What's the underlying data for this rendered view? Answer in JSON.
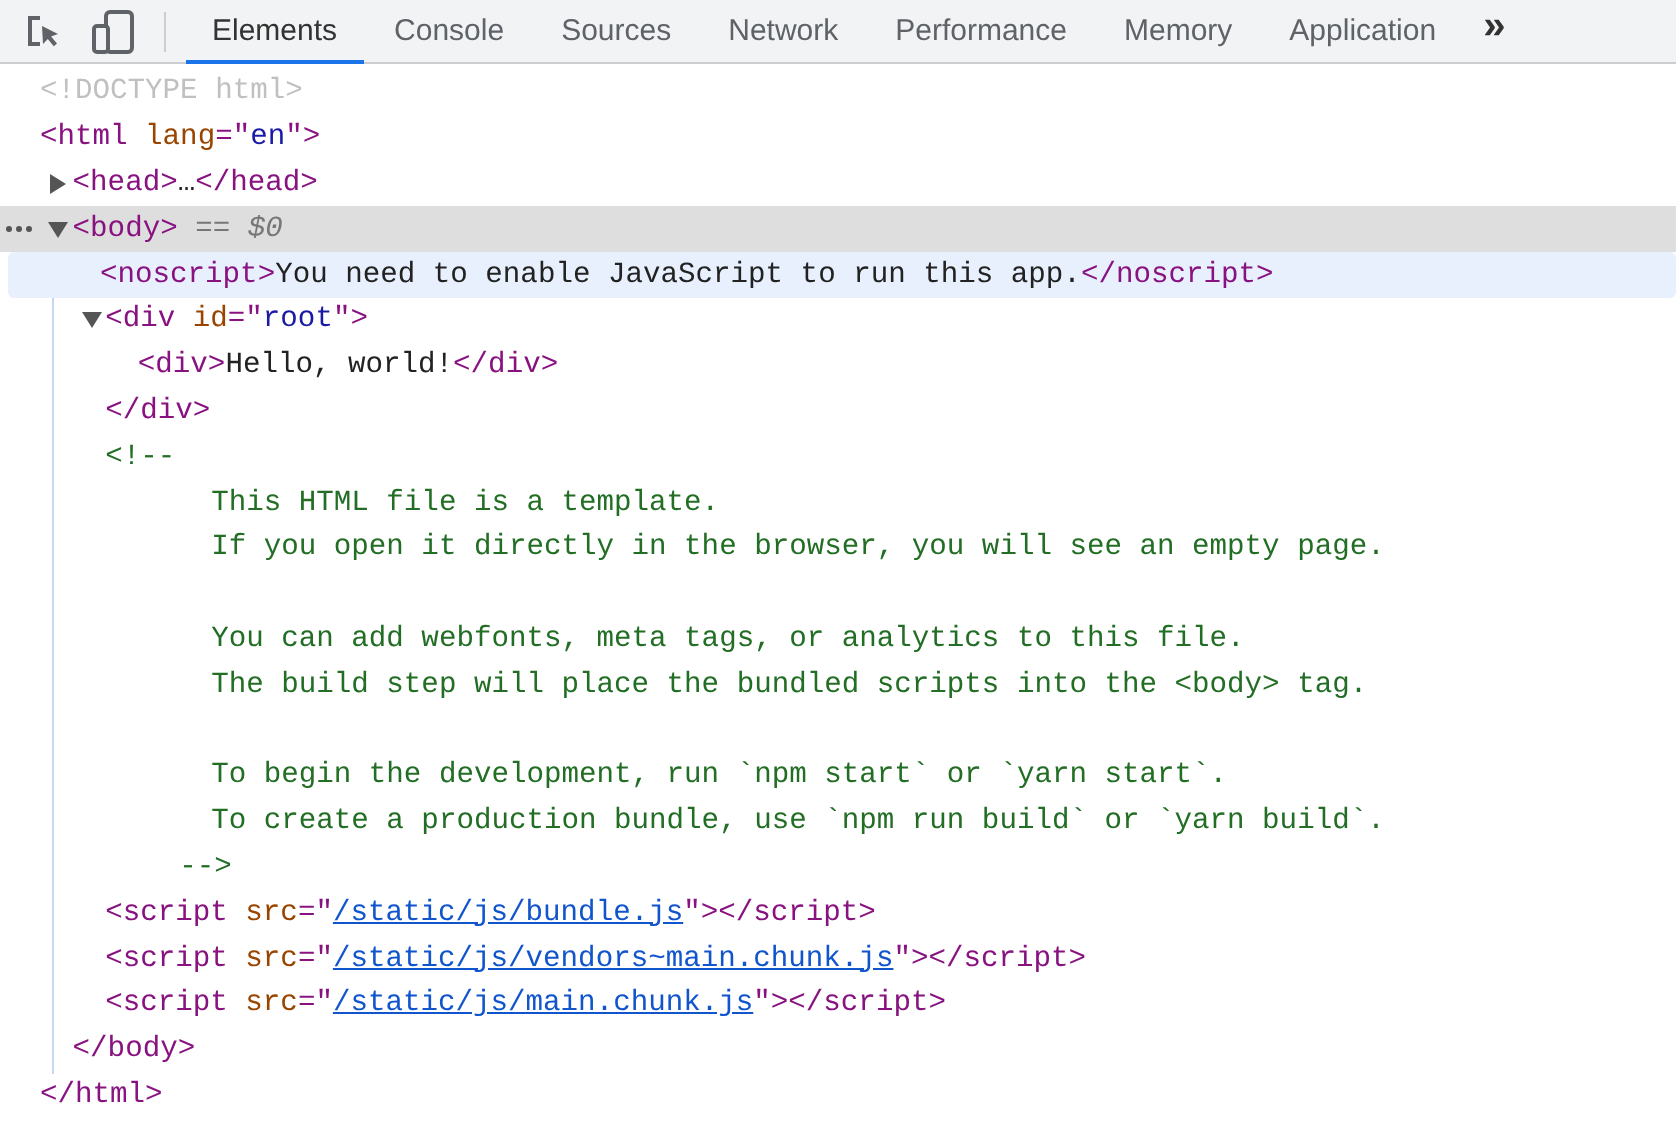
{
  "tabs": [
    {
      "label": "Elements",
      "selected": true
    },
    {
      "label": "Console",
      "selected": false
    },
    {
      "label": "Sources",
      "selected": false
    },
    {
      "label": "Network",
      "selected": false
    },
    {
      "label": "Performance",
      "selected": false
    },
    {
      "label": "Memory",
      "selected": false
    },
    {
      "label": "Application",
      "selected": false
    }
  ],
  "overflow": "»",
  "tree": [
    {
      "kind": "element",
      "open": [
        {
          "kind": "doctype",
          "text": "<!DOCTYPE html>"
        }
      ]
    },
    {
      "kind": "element",
      "open": [
        {
          "kind": "tag",
          "text": "<html "
        },
        {
          "kind": "attr-name",
          "text": "lang"
        },
        {
          "kind": "tag",
          "text": "=\""
        },
        {
          "kind": "attr-value",
          "text": "en"
        },
        {
          "kind": "tag",
          "text": "\">"
        }
      ],
      "close": [
        {
          "kind": "tag",
          "text": "</html>"
        }
      ],
      "children": [
        {
          "kind": "element",
          "expanded": false,
          "open": [
            {
              "kind": "tag",
              "text": "<head>"
            },
            {
              "kind": "text",
              "text": "…"
            },
            {
              "kind": "tag",
              "text": "</head>"
            }
          ]
        },
        {
          "kind": "element",
          "expanded": true,
          "selected": true,
          "suffix": "== $0",
          "open": [
            {
              "kind": "tag",
              "text": "<body>"
            }
          ],
          "close": [
            {
              "kind": "tag",
              "text": "</body>"
            }
          ],
          "children": [
            {
              "kind": "element",
              "hovered": true,
              "open": [
                {
                  "kind": "tag",
                  "text": "<noscript>"
                },
                {
                  "kind": "text",
                  "text": "You need to enable JavaScript to run this app."
                },
                {
                  "kind": "tag",
                  "text": "</noscript>"
                }
              ]
            },
            {
              "kind": "element",
              "expanded": true,
              "open": [
                {
                  "kind": "tag",
                  "text": "<div "
                },
                {
                  "kind": "attr-name",
                  "text": "id"
                },
                {
                  "kind": "tag",
                  "text": "=\""
                },
                {
                  "kind": "attr-value",
                  "text": "root"
                },
                {
                  "kind": "tag",
                  "text": "\">"
                }
              ],
              "close": [
                {
                  "kind": "tag",
                  "text": "</div>"
                }
              ],
              "children": [
                {
                  "kind": "element",
                  "open": [
                    {
                      "kind": "tag",
                      "text": "<div>"
                    },
                    {
                      "kind": "text",
                      "text": "Hello, world!"
                    },
                    {
                      "kind": "tag",
                      "text": "</div>"
                    }
                  ]
                }
              ]
            },
            {
              "kind": "comment",
              "open": "<!--",
              "close": "-->",
              "paragraphs": [
                [
                  "This HTML file is a template.",
                  "If you open it directly in the browser, you will see an empty page."
                ],
                [
                  "You can add webfonts, meta tags, or analytics to this file.",
                  "The build step will place the bundled scripts into the <body> tag."
                ],
                [
                  "To begin the development, run `npm start` or `yarn start`.",
                  "To create a production bundle, use `npm run build` or `yarn build`."
                ]
              ]
            },
            {
              "kind": "element",
              "open": [
                {
                  "kind": "tag",
                  "text": "<script "
                },
                {
                  "kind": "attr-name",
                  "text": "src"
                },
                {
                  "kind": "tag",
                  "text": "=\""
                },
                {
                  "kind": "link",
                  "text": "/static/js/bundle.js"
                },
                {
                  "kind": "tag",
                  "text": "\"></script>"
                }
              ]
            },
            {
              "kind": "element",
              "open": [
                {
                  "kind": "tag",
                  "text": "<script "
                },
                {
                  "kind": "attr-name",
                  "text": "src"
                },
                {
                  "kind": "tag",
                  "text": "=\""
                },
                {
                  "kind": "link",
                  "text": "/static/js/vendors~main.chunk.js"
                },
                {
                  "kind": "tag",
                  "text": "\"></script>"
                }
              ]
            },
            {
              "kind": "element",
              "open": [
                {
                  "kind": "tag",
                  "text": "<script "
                },
                {
                  "kind": "attr-name",
                  "text": "src"
                },
                {
                  "kind": "tag",
                  "text": "=\""
                },
                {
                  "kind": "link",
                  "text": "/static/js/main.chunk.js"
                },
                {
                  "kind": "tag",
                  "text": "\"></script>"
                }
              ]
            }
          ]
        }
      ]
    }
  ]
}
